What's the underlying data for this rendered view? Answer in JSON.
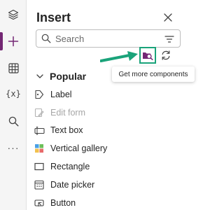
{
  "rail": {
    "items": [
      {
        "icon": "layers-icon"
      },
      {
        "icon": "plus-icon",
        "active": true
      },
      {
        "icon": "table-grid-icon"
      },
      {
        "icon": "variables-icon",
        "label": "{x}"
      },
      {
        "icon": "search-icon"
      },
      {
        "icon": "more-icon",
        "label": "···"
      }
    ],
    "accent": "#742774"
  },
  "panel": {
    "title": "Insert",
    "search_placeholder": "Search",
    "get_more_tooltip": "Get more components",
    "section_label": "Popular",
    "items": [
      {
        "label": "Label",
        "icon": "label-icon"
      },
      {
        "label": "Edit form",
        "icon": "edit-form-icon",
        "disabled": true
      },
      {
        "label": "Text box",
        "icon": "textbox-icon"
      },
      {
        "label": "Vertical gallery",
        "icon": "gallery-icon"
      },
      {
        "label": "Rectangle",
        "icon": "rectangle-icon"
      },
      {
        "label": "Date picker",
        "icon": "calendar-icon"
      },
      {
        "label": "Button",
        "icon": "button-icon"
      }
    ]
  },
  "colors": {
    "highlight": "#1aa37a",
    "accent": "#742774"
  }
}
